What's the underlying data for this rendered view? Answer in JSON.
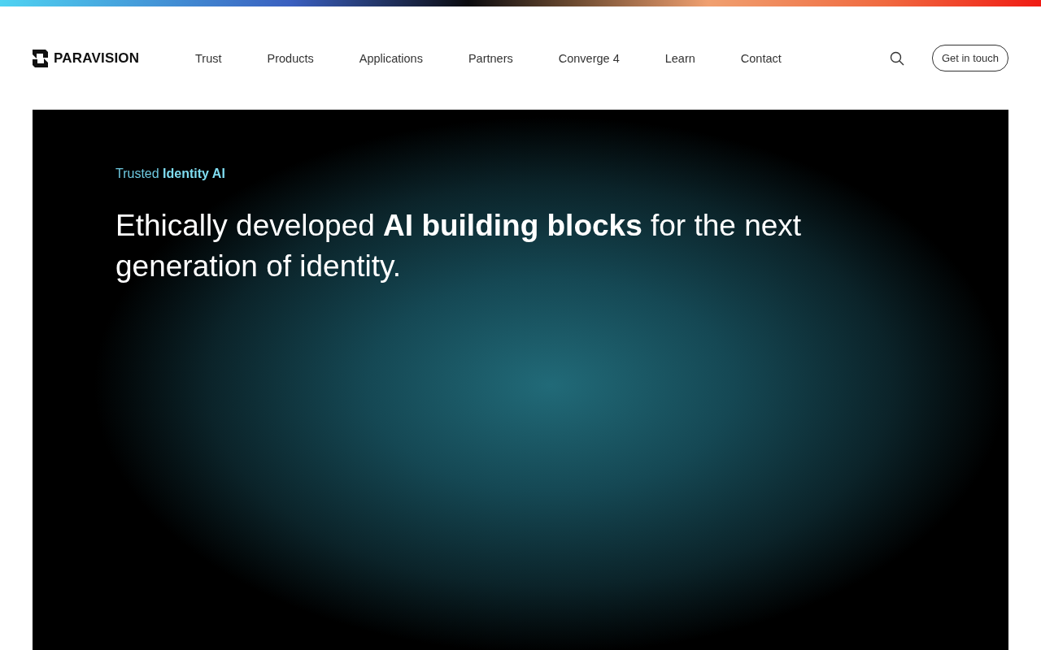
{
  "header": {
    "logo": "PARAVISION",
    "nav": [
      {
        "label": "Trust"
      },
      {
        "label": "Products"
      },
      {
        "label": "Applications"
      },
      {
        "label": "Partners"
      },
      {
        "label": "Converge 4"
      },
      {
        "label": "Learn"
      },
      {
        "label": "Contact"
      }
    ],
    "cta": "Get in touch"
  },
  "hero": {
    "eyebrow": "Trusted **Identity AI**",
    "headline": "Ethically developed **AI building blocks** for the next generation of identity."
  }
}
